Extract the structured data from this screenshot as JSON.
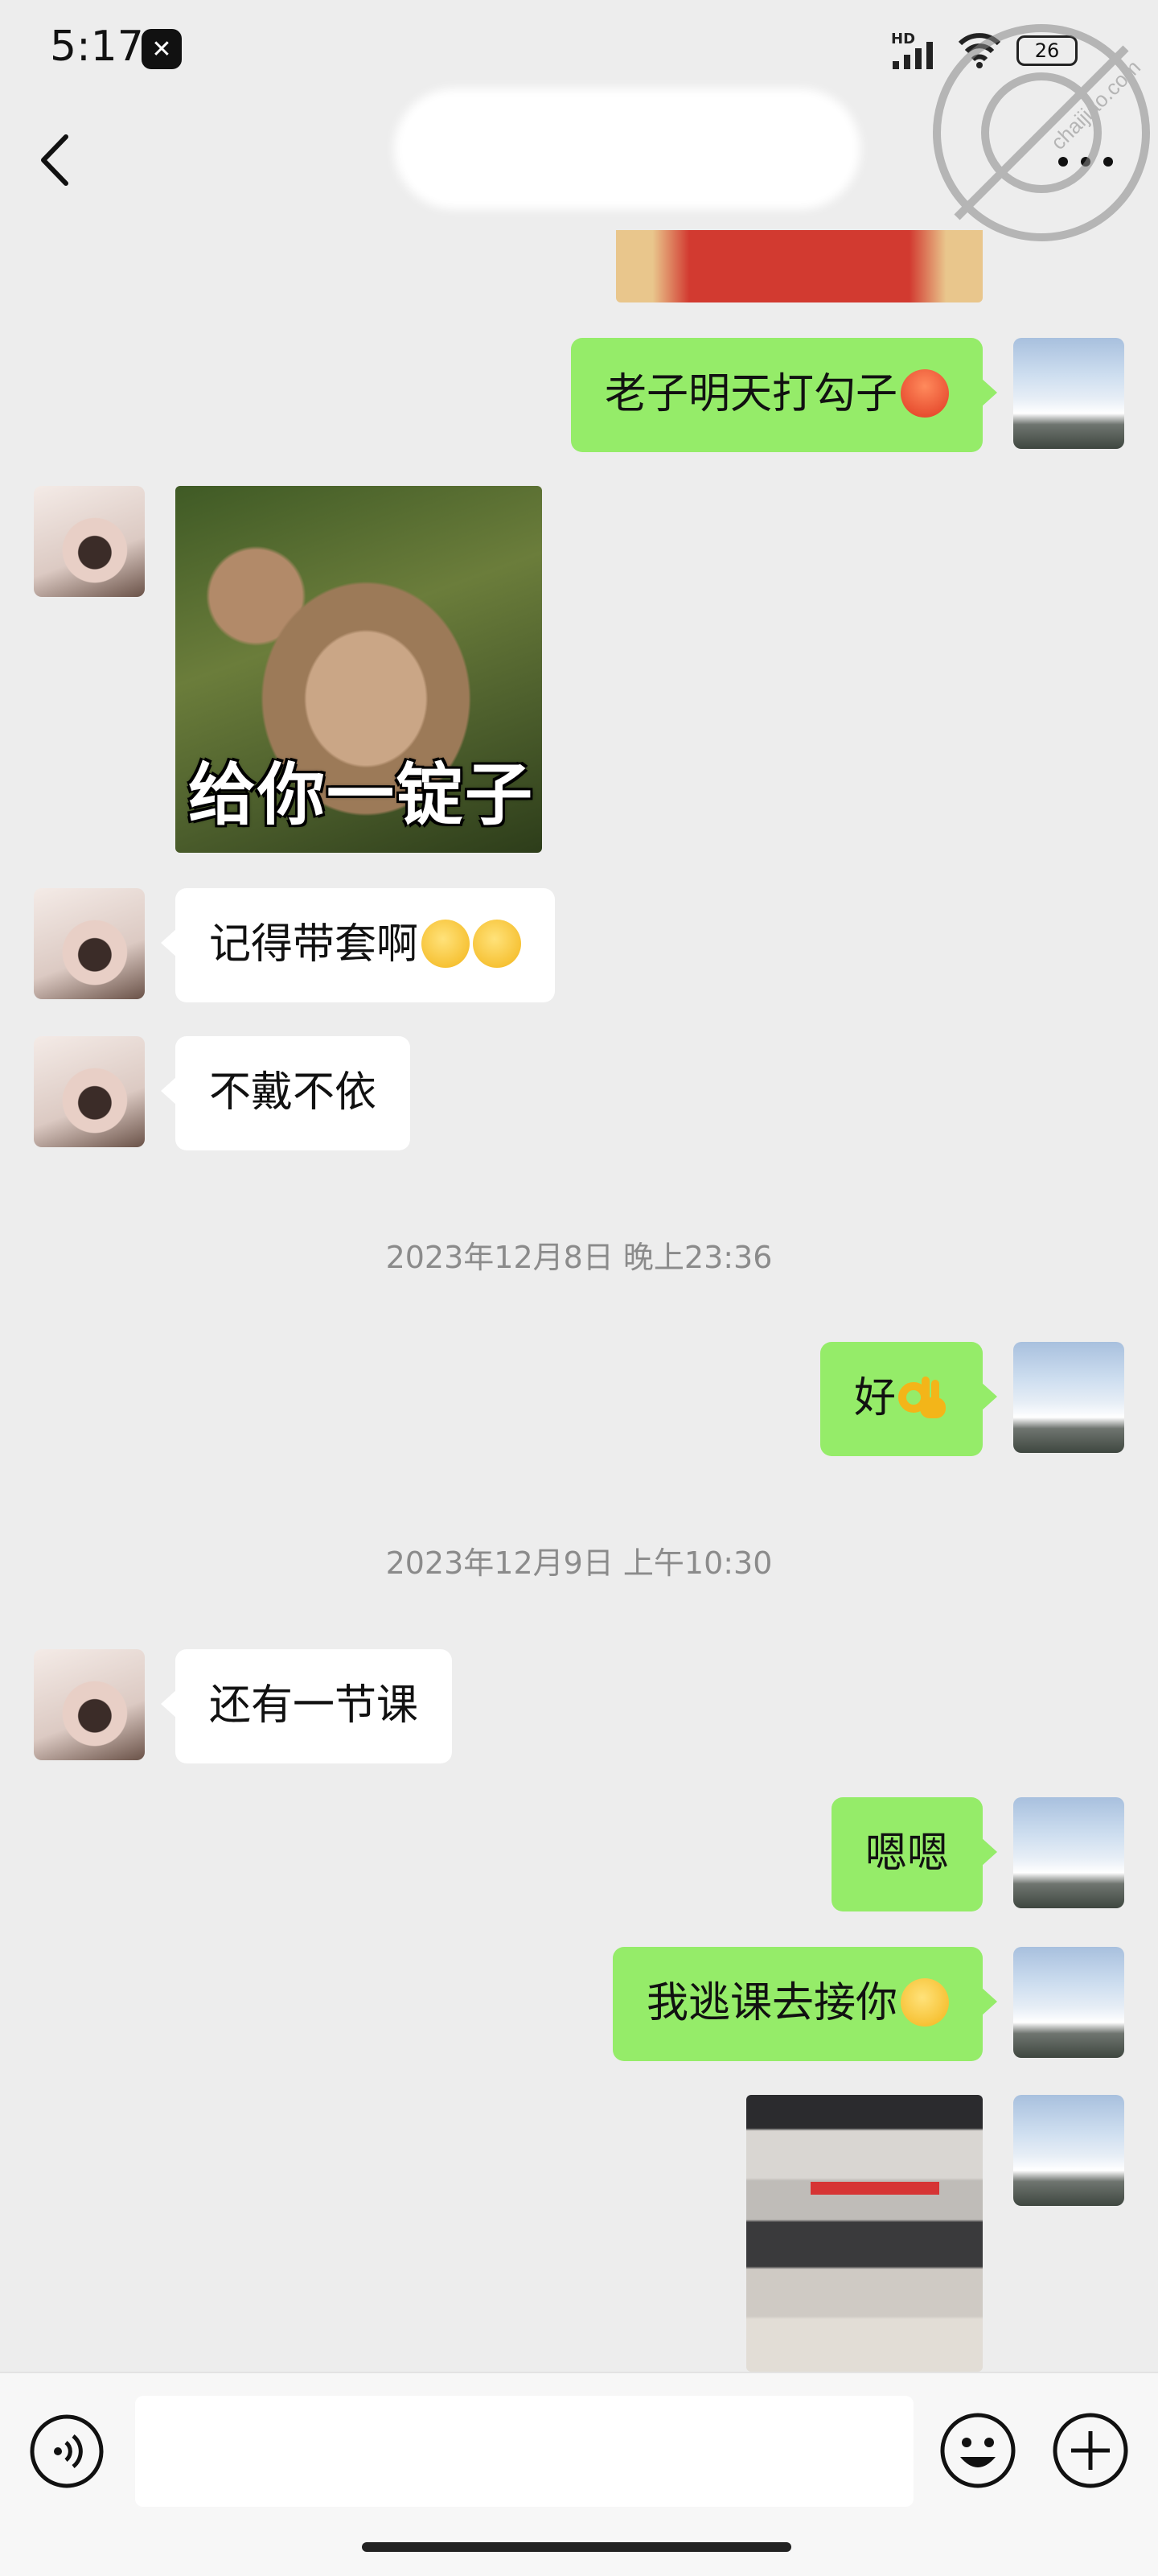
{
  "status_bar": {
    "time": "5:17",
    "network_label": "HD",
    "battery": "26"
  },
  "header": {
    "back_icon": "chevron-left-icon",
    "more_icon": "more-dots-icon"
  },
  "watermark": {
    "text": "chaijiao.com",
    "icon": "stamp-logo"
  },
  "messages": [
    {
      "side": "me",
      "type": "image",
      "desc": "cropped-photo"
    },
    {
      "side": "me",
      "type": "text",
      "text": "老子明天打勾子",
      "emoji": "angry-face-emoji"
    },
    {
      "side": "her",
      "type": "sticker",
      "caption": "给你一锭子"
    },
    {
      "side": "her",
      "type": "text",
      "text": "记得带套啊",
      "emoji": "smile-emoji"
    },
    {
      "side": "her",
      "type": "text",
      "text": "不戴不依"
    },
    {
      "type": "timestamp",
      "text": "2023年12月8日 晚上23:36"
    },
    {
      "side": "me",
      "type": "text",
      "text": "好",
      "emoji": "ok-hand-emoji"
    },
    {
      "type": "timestamp",
      "text": "2023年12月9日 上午10:30"
    },
    {
      "side": "her",
      "type": "text",
      "text": "还有一节课"
    },
    {
      "side": "me",
      "type": "text",
      "text": "嗯嗯"
    },
    {
      "side": "me",
      "type": "text",
      "text": "我逃课去接你",
      "emoji": "grin-emoji"
    },
    {
      "side": "me",
      "type": "image",
      "desc": "conference-hall-photo"
    }
  ],
  "input_bar": {
    "voice_icon": "voice-icon",
    "emoji_icon": "emoji-icon",
    "plus_icon": "plus-icon"
  },
  "colors": {
    "background": "#ededed",
    "my_bubble": "#95ec69",
    "her_bubble": "#ffffff",
    "timestamp": "#8b8b8b"
  }
}
